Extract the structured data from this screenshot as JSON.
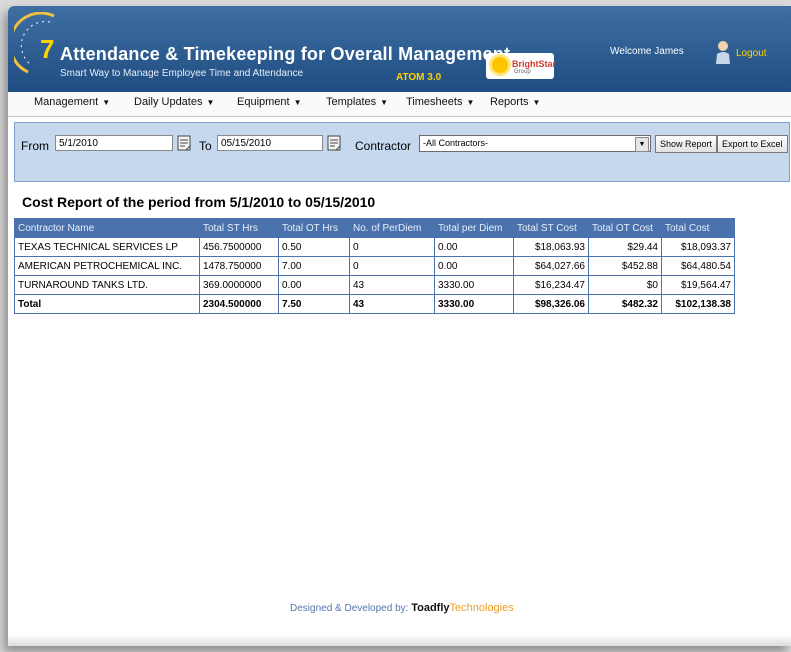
{
  "header": {
    "title": "Attendance & Timekeeping for Overall Management",
    "subtitle": "Smart Way to Manage Employee Time and Attendance",
    "version": "ATOM 3.0",
    "logo_text": "BrightStar",
    "logo_sub": "Group",
    "welcome": "Welcome James",
    "logout": "Logout"
  },
  "menu": [
    {
      "label": "Management"
    },
    {
      "label": "Daily Updates"
    },
    {
      "label": "Equipment"
    },
    {
      "label": "Templates"
    },
    {
      "label": "Timesheets"
    },
    {
      "label": "Reports"
    }
  ],
  "filters": {
    "from_label": "From",
    "from_value": "5/1/2010",
    "to_label": "To",
    "to_value": "05/15/2010",
    "contractor_label": "Contractor",
    "contractor_value": "-All Contractors-",
    "show_report": "Show Report",
    "export": "Export to Excel"
  },
  "report": {
    "title": "Cost Report of the period from 5/1/2010 to 05/15/2010",
    "columns": [
      "Contractor Name",
      "Total ST Hrs",
      "Total OT Hrs",
      "No. of PerDiem",
      "Total per Diem",
      "Total ST Cost",
      "Total OT Cost",
      "Total Cost"
    ],
    "rows": [
      [
        "TEXAS TECHNICAL SERVICES LP",
        "456.7500000",
        "0.50",
        "0",
        "0.00",
        "$18,063.93",
        "$29.44",
        "$18,093.37"
      ],
      [
        "AMERICAN PETROCHEMICAL INC.",
        "1478.750000",
        "7.00",
        "0",
        "0.00",
        "$64,027.66",
        "$452.88",
        "$64,480.54"
      ],
      [
        "TURNAROUND TANKS LTD.",
        "369.0000000",
        "0.00",
        "43",
        "3330.00",
        "$16,234.47",
        "$0",
        "$19,564.47"
      ]
    ],
    "total": [
      "Total",
      "2304.500000",
      "7.50",
      "43",
      "3330.00",
      "$98,326.06",
      "$482.32",
      "$102,138.38"
    ]
  },
  "footer": {
    "prefix": "Designed & Developed by:",
    "brand1": "Toadfly",
    "brand2": "Technologies"
  },
  "colors": {
    "header_bg": "#2a5a8e",
    "accent": "#ffd300",
    "table_header": "#4a73ad",
    "filter_bg": "#c6d8ee"
  }
}
